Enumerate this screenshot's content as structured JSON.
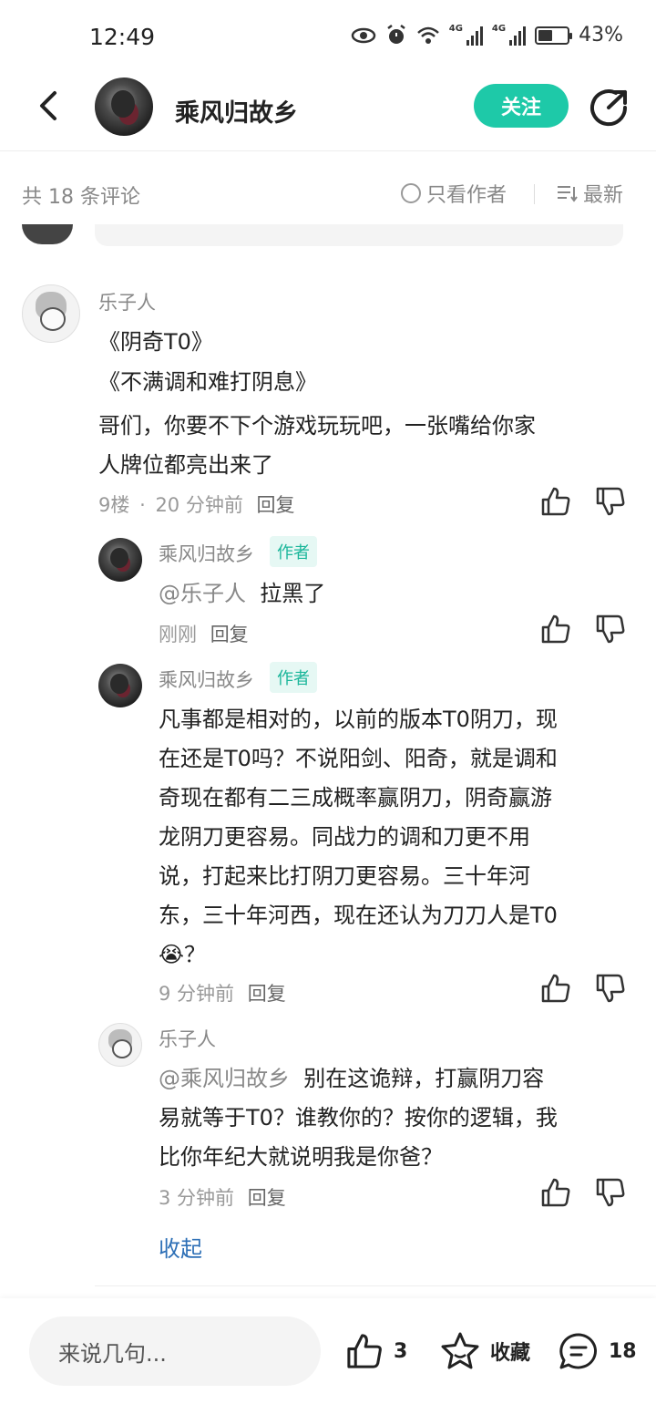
{
  "status": {
    "time": "12:49",
    "battery": "43%",
    "network": "4G"
  },
  "header": {
    "title": "乘风归故乡",
    "follow_label": "关注"
  },
  "comments_bar": {
    "count_text": "共 18 条评论",
    "author_only": "只看作者",
    "sort": "最新"
  },
  "comments": [
    {
      "user": "乐子人",
      "lines": [
        "《阴奇T0》",
        "《不满调和难打阴息》",
        "哥们，你要不下个游戏玩玩吧，一张嘴给你家",
        "人牌位都亮出来了"
      ],
      "floor": "9楼",
      "time": "20 分钟前",
      "reply": "回复"
    }
  ],
  "replies": [
    {
      "user": "乘风归故乡",
      "badge": "作者",
      "mention": "@乐子人",
      "text": "拉黑了",
      "time": "刚刚",
      "reply": "回复"
    },
    {
      "user": "乘风归故乡",
      "badge": "作者",
      "lines": [
        "凡事都是相对的，以前的版本T0阴刀，现",
        "在还是T0吗？不说阳剑、阳奇，就是调和",
        "奇现在都有二三成概率赢阴刀，阴奇赢游",
        "龙阴刀更容易。同战力的调和刀更不用",
        "说，打起来比打阴刀更容易。三十年河",
        "东，三十年河西，现在还认为刀刀人是T0"
      ],
      "last_line": "😭？",
      "time": "9 分钟前",
      "reply": "回复"
    },
    {
      "user": "乐子人",
      "mention": "@乘风归故乡",
      "first_line_rest": "别在这诡辩，打赢阴刀容",
      "lines": [
        "易就等于T0？谁教你的？按你的逻辑，我",
        "比你年纪大就说明我是你爸？"
      ],
      "time": "3 分钟前",
      "reply": "回复"
    }
  ],
  "collapse_label": "收起",
  "bottom": {
    "input_placeholder": "来说几句...",
    "like_count": "3",
    "favorite_label": "收藏",
    "comment_count": "18"
  },
  "colors": {
    "accent": "#1ec9a8",
    "link": "#2d6fb6",
    "badge_bg": "#e6f8f4"
  }
}
